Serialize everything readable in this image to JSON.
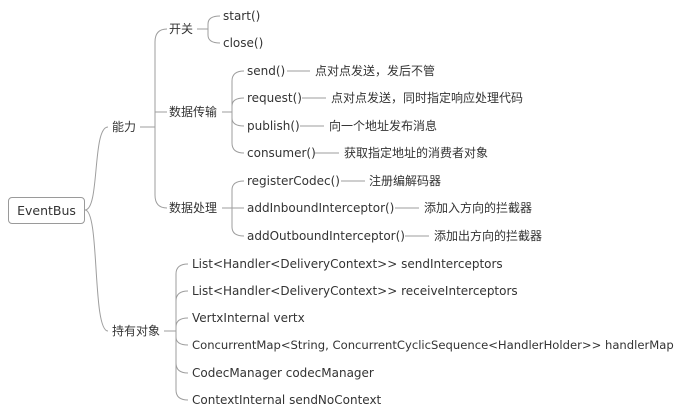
{
  "root": {
    "label": "EventBus"
  },
  "branches": {
    "ability": {
      "label": "能力",
      "groups": {
        "switch": {
          "label": "开关",
          "items": [
            {
              "method": "start()"
            },
            {
              "method": "close()"
            }
          ]
        },
        "transfer": {
          "label": "数据传输",
          "items": [
            {
              "method": "send()",
              "note": "点对点发送，发后不管"
            },
            {
              "method": "request()",
              "note": "点对点发送，同时指定响应处理代码"
            },
            {
              "method": "publish()",
              "note": "向一个地址发布消息"
            },
            {
              "method": "consumer()",
              "note": "获取指定地址的消费者对象"
            }
          ]
        },
        "processing": {
          "label": "数据处理",
          "items": [
            {
              "method": "registerCodec()",
              "note": "注册编解码器"
            },
            {
              "method": "addInboundInterceptor()",
              "note": "添加入方向的拦截器"
            },
            {
              "method": "addOutboundInterceptor()",
              "note": "添加出方向的拦截器"
            }
          ]
        }
      }
    },
    "held": {
      "label": "持有对象",
      "items": [
        "List<Handler<DeliveryContext>> sendInterceptors",
        "List<Handler<DeliveryContext>> receiveInterceptors",
        "VertxInternal vertx",
        "ConcurrentMap<String, ConcurrentCyclicSequence<HandlerHolder>> handlerMap",
        "CodecManager codecManager",
        "ContextInternal sendNoContext"
      ]
    }
  }
}
